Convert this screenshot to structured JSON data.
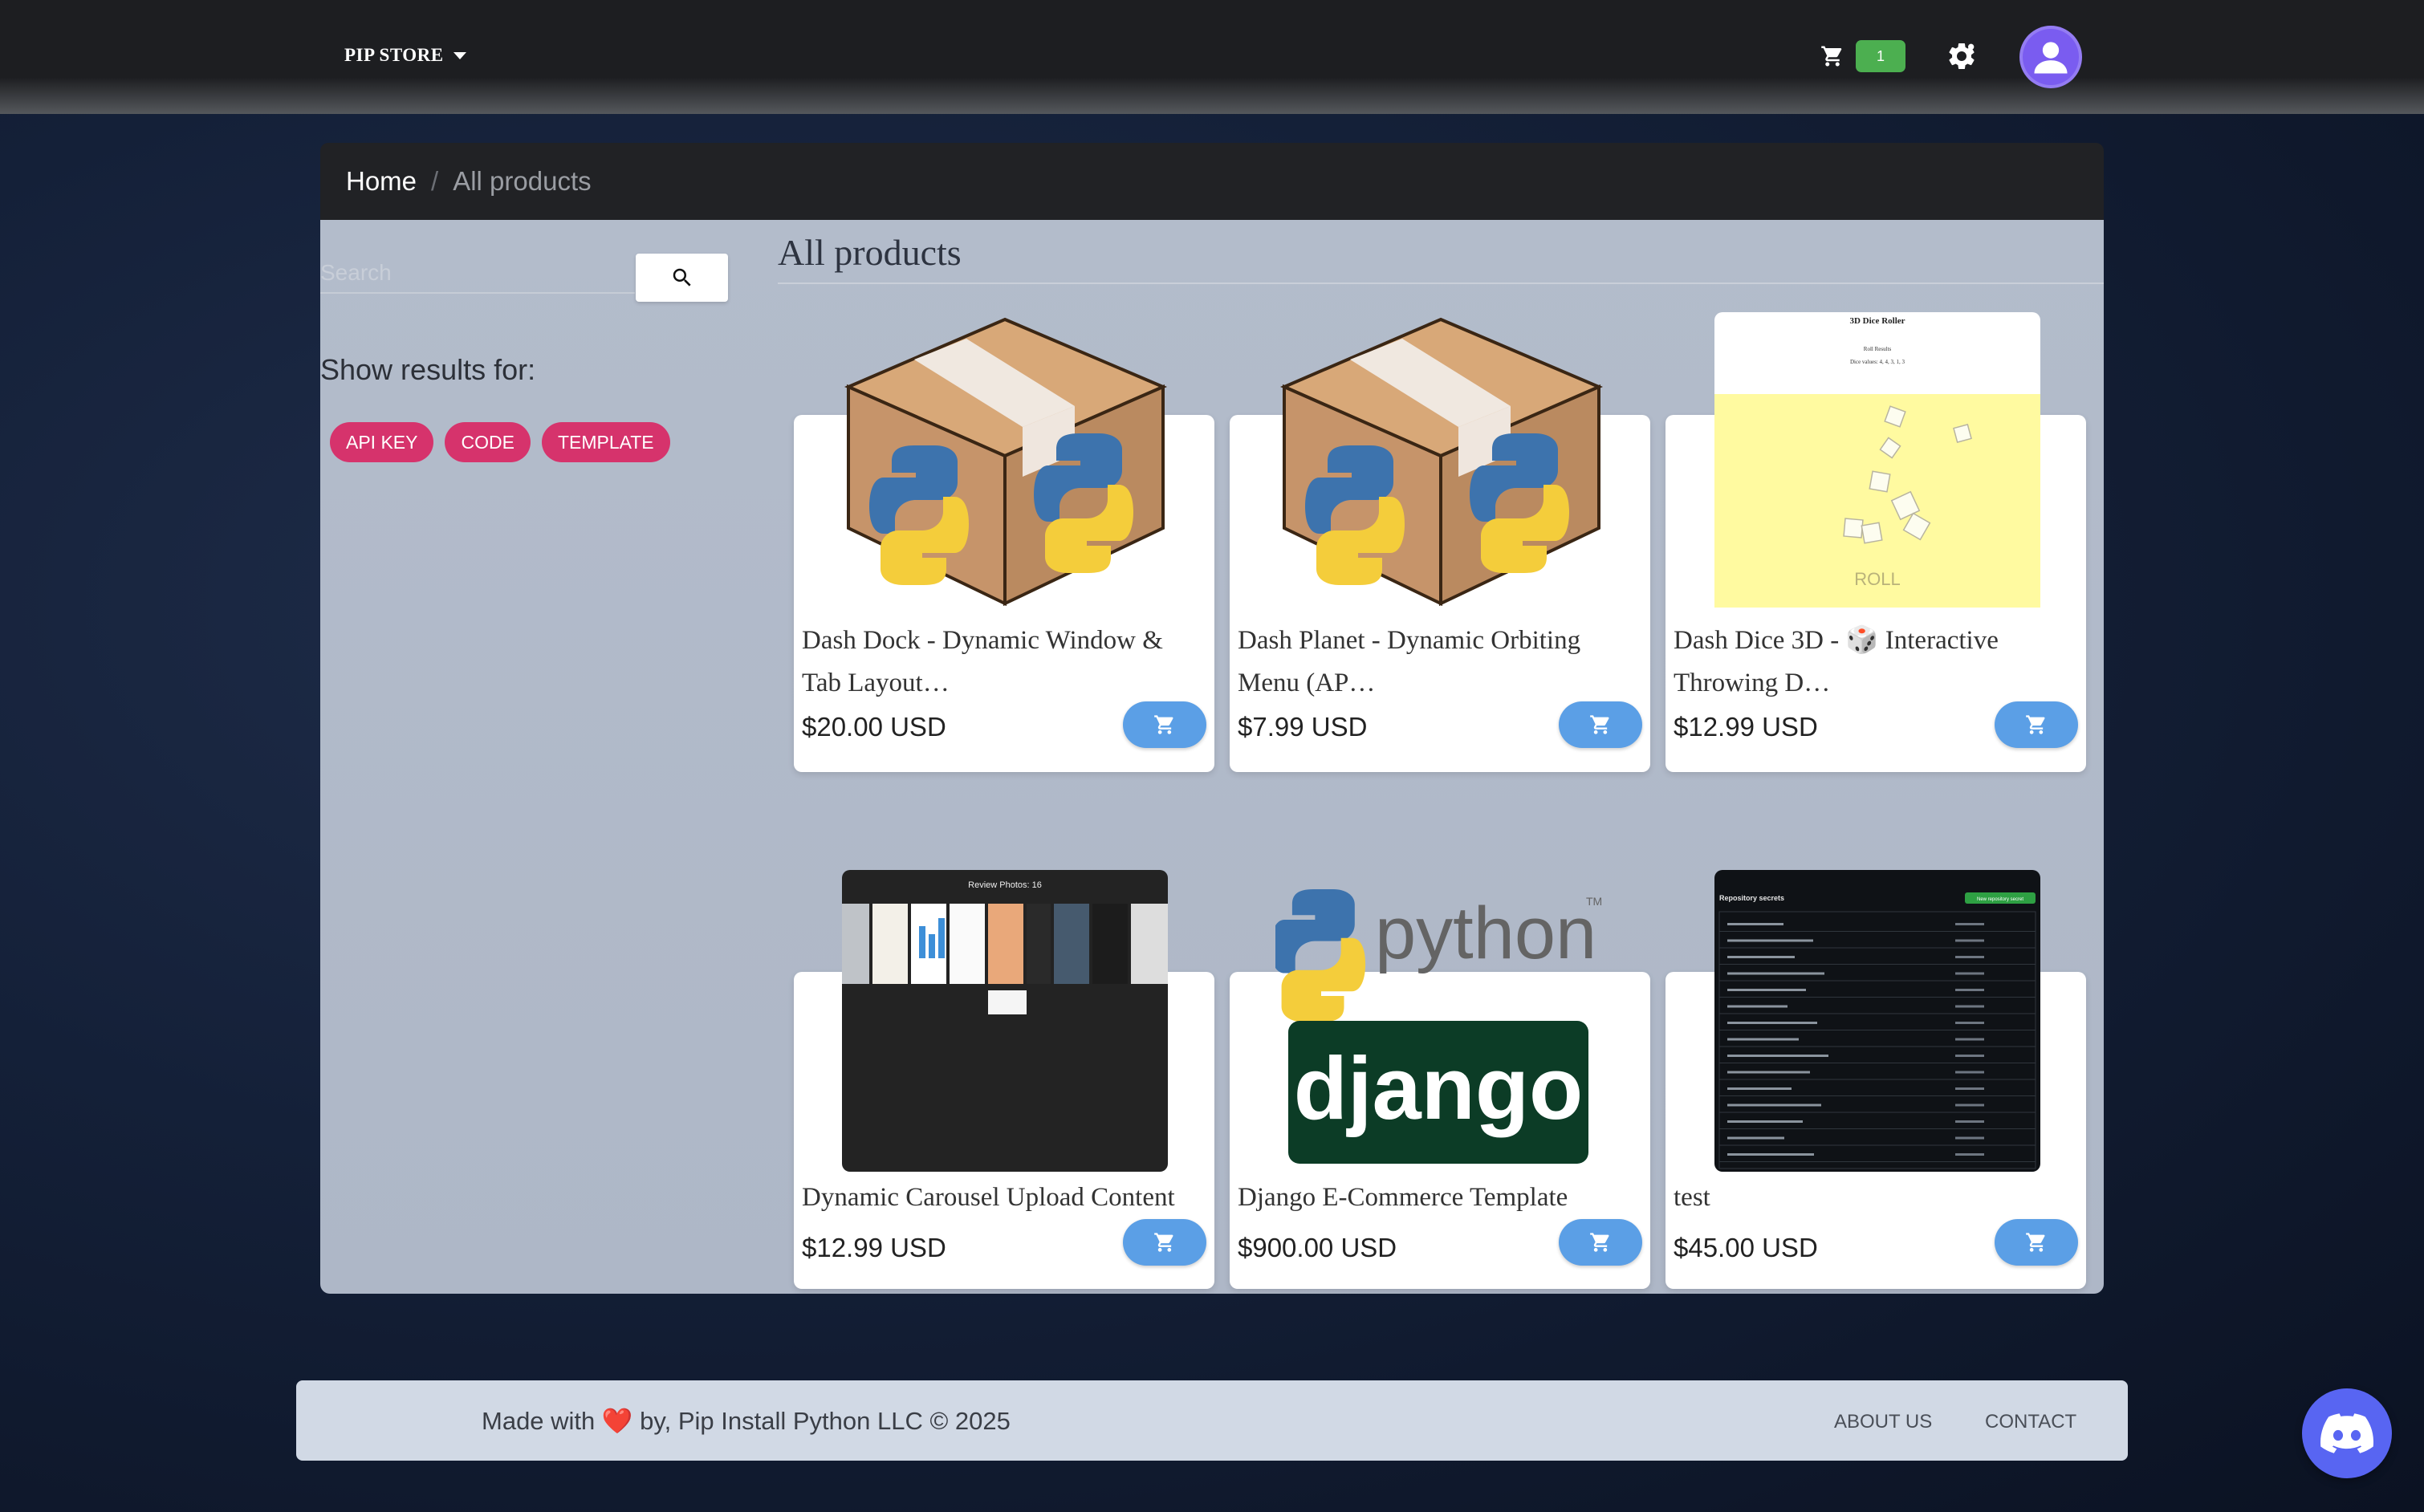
{
  "navbar": {
    "brand": "PIP STORE",
    "cart_count": "1",
    "icons": [
      "cart-icon",
      "gear-icon",
      "user-avatar-icon"
    ]
  },
  "breadcrumb": {
    "home": "Home",
    "separator": "/",
    "current": "All products"
  },
  "sidebar": {
    "search_placeholder": "Search",
    "show_results": "Show results for:",
    "chips": [
      {
        "label": "API KEY"
      },
      {
        "label": "CODE"
      },
      {
        "label": "TEMPLATE"
      }
    ]
  },
  "main": {
    "heading": "All products",
    "products": [
      {
        "title": "Dash Dock - Dynamic Window & Tab Layout…",
        "price": "$20.00 USD",
        "image": "python-box"
      },
      {
        "title": "Dash Planet - Dynamic Orbiting Menu (AP…",
        "price": "$7.99 USD",
        "image": "python-box"
      },
      {
        "title": "Dash Dice 3D - 🎲 Interactive Throwing D…",
        "price": "$12.99 USD",
        "image": "dice-roller",
        "image_text": {
          "title": "3D Dice Roller",
          "sub1": "Roll Results",
          "sub2": "Dice values: 4, 4, 3, 1, 3",
          "roll": "ROLL"
        }
      },
      {
        "title": "Dynamic Carousel Upload Content",
        "price": "$12.99 USD",
        "image": "carousel",
        "image_text": {
          "title": "Review Photos: 16"
        }
      },
      {
        "title": "Django E-Commerce Template",
        "price": "$900.00 USD",
        "image": "python-django",
        "image_text": {
          "python": "python",
          "tm": "TM",
          "django": "django"
        }
      },
      {
        "title": "test",
        "price": "$45.00 USD",
        "image": "secrets-list",
        "image_text": {
          "header": "Repository secrets",
          "button": "New repository secret"
        }
      }
    ]
  },
  "footer": {
    "made_with": "Made with",
    "heart": "❤️",
    "by": "by, Pip Install Python LLC © 2025",
    "links": [
      "ABOUT US",
      "CONTACT"
    ]
  },
  "colors": {
    "chip": "#d6336c",
    "cart_button": "#5b9fe6",
    "badge": "#4caf50",
    "discord": "#5865f2"
  }
}
